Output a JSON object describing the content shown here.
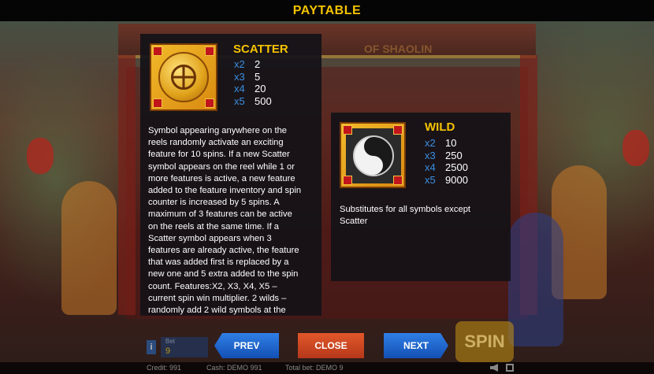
{
  "title": "PAYTABLE",
  "background_logo": "OF SHAOLIN",
  "scatter": {
    "name": "SCATTER",
    "pays": [
      {
        "mult": "x2",
        "value": "2"
      },
      {
        "mult": "x3",
        "value": "5"
      },
      {
        "mult": "x4",
        "value": "20"
      },
      {
        "mult": "x5",
        "value": "500"
      }
    ],
    "description_lines": [
      "Symbol appearing anywhere on the",
      "reels randomly activate an exciting",
      "feature for 10 spins. If a new Scatter",
      "symbol appears on the reel while 1 or",
      "more features is active, a new feature",
      "added to the feature inventory and spin",
      "counter is increased by 5 spins. A",
      "maximum of 3 features can be active",
      "on the reels at the same time. If a",
      "Scatter symbol appears when 3",
      "features are already active, the feature",
      "that was added first is replaced by a",
      "new one and 5 extra added to the spin",
      "count. Features:X2, X3, X4, X5 –",
      "current spin win multiplier. 2 wilds –",
      "randomly add 2 wild symbols at the"
    ]
  },
  "wild": {
    "name": "WILD",
    "pays": [
      {
        "mult": "x2",
        "value": "10"
      },
      {
        "mult": "x3",
        "value": "250"
      },
      {
        "mult": "x4",
        "value": "2500"
      },
      {
        "mult": "x5",
        "value": "9000"
      }
    ],
    "description_lines": [
      "Substitutes for all symbols except",
      "Scatter"
    ]
  },
  "buttons": {
    "prev": "PREV",
    "close": "CLOSE",
    "next": "NEXT",
    "spin": "SPIN",
    "info": "i"
  },
  "bet": {
    "label": "Bet",
    "value": "9"
  },
  "status": {
    "credit": "Credit: 991",
    "cash": "Cash: DEMO 991",
    "total_bet": "Total bet: DEMO 9"
  },
  "colors": {
    "title": "#f5c300",
    "multiplier": "#3b8fe0",
    "nav_button": "#1f66cf",
    "close_button": "#cc4722"
  },
  "icons": {
    "sound": "speaker-icon",
    "fullscreen": "fullscreen-icon"
  }
}
